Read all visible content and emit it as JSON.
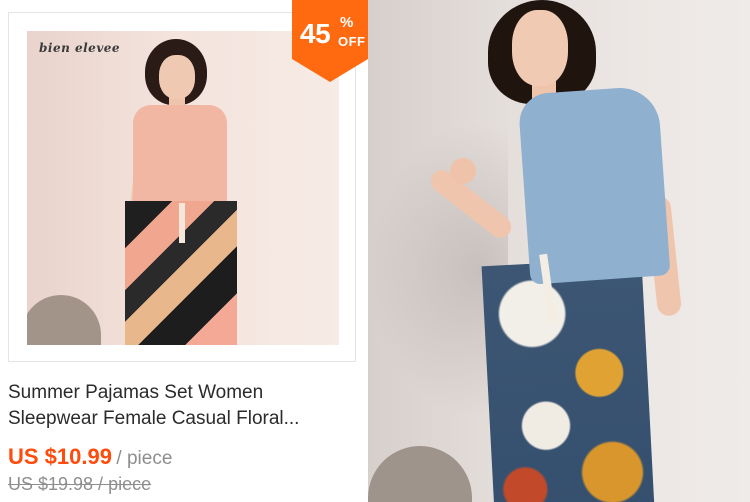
{
  "listing": {
    "brand_logo_text": "bien elevee",
    "discount": {
      "number": "45",
      "percent_sign": "%",
      "off_label": "OFF"
    },
    "title_line1": "Summer Pajamas Set Women",
    "title_line2": "Sleepwear Female Casual Floral...",
    "price": "US $10.99",
    "unit": "/ piece",
    "original_price": "US $19.98 / piece"
  },
  "colors": {
    "badge_orange": "#ff6a10",
    "price_orange": "#ff4b0c",
    "muted_gray": "#8e8e8e",
    "title_text": "#2b2b2b"
  }
}
